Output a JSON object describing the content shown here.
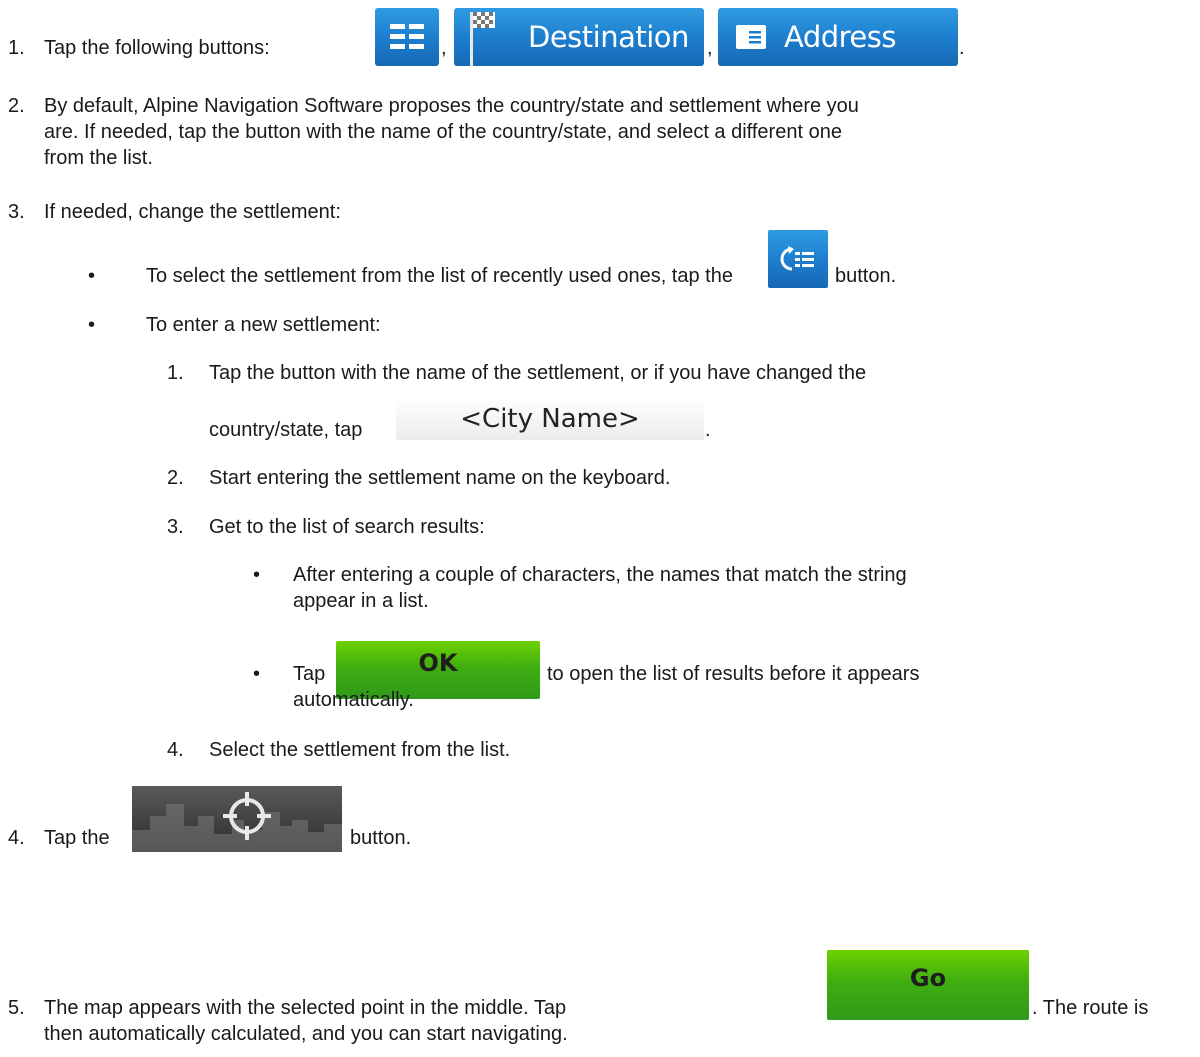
{
  "step1": {
    "number": "1.",
    "text": "Tap the following buttons:",
    "comma1": ",",
    "comma2": ",",
    "period": ".",
    "menu_icon": "menu-grid-icon",
    "destination_label": "Destination",
    "destination_icon": "checkered-flag-icon",
    "address_label": "Address",
    "address_icon": "document-icon"
  },
  "step2": {
    "number": "2.",
    "lines": [
      "By default, Alpine Navigation Software proposes the country/state and settlement where you",
      "are. If needed, tap the button with the name of the country/state, and select a different one",
      "from the list."
    ]
  },
  "step3": {
    "number": "3.",
    "text": "If needed, change the settlement:",
    "bullet_a": {
      "before": "To select the settlement from the list of recently used ones, tap the",
      "after": "button.",
      "icon": "recent-list-icon"
    },
    "bullet_b": {
      "text": "To enter a new settlement:",
      "sub1": {
        "number": "1.",
        "line1": "Tap the button with the name of the settlement, or if you have changed the",
        "line2": "country/state, tap",
        "button_label": "<City Name>",
        "period": "."
      },
      "sub2": {
        "number": "2.",
        "text": "Start entering the settlement name on the keyboard."
      },
      "sub3": {
        "number": "3.",
        "text": "Get to the list of search results:",
        "bullet1": {
          "line1": "After entering a couple of characters, the names that match the string",
          "line2": "appear in a list."
        },
        "bullet2": {
          "before": "Tap",
          "button_label": "OK",
          "after": "to open the list of results before it appears",
          "line2": "automatically."
        }
      },
      "sub4": {
        "number": "4.",
        "text": "Select the settlement from the list."
      }
    }
  },
  "step4": {
    "number": "4.",
    "before": "Tap the",
    "after": "button.",
    "icon": "map-crosshair-icon"
  },
  "step5": {
    "number": "5.",
    "before": "The map appears with the selected point in the middle. Tap",
    "button_label": "Go",
    "after": ". The route is",
    "line2": "then automatically calculated, and you can start navigating."
  },
  "bullet_glyph": "•"
}
